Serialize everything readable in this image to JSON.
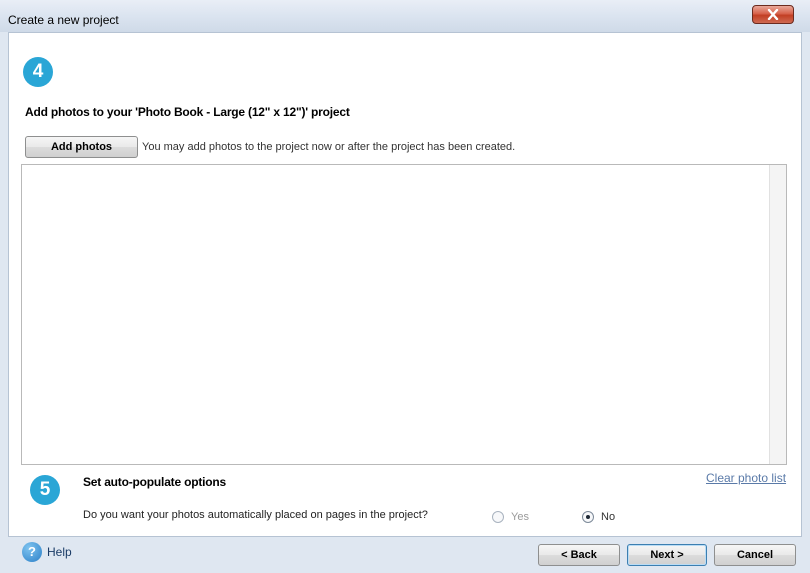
{
  "window": {
    "title": "Create a new project"
  },
  "step4": {
    "number": "4",
    "heading": "Add photos to your 'Photo Book - Large (12\" x 12\")' project",
    "add_photos_label": "Add photos",
    "note": "You may add photos to the project now or after the project has been created."
  },
  "photo_list": {
    "items": []
  },
  "step5": {
    "number": "5",
    "heading": "Set auto-populate options",
    "clear_link": "Clear photo list",
    "question": "Do you want your photos automatically placed on pages in the project?",
    "options": [
      {
        "label": "Yes",
        "selected": false,
        "enabled": false
      },
      {
        "label": "No",
        "selected": true,
        "enabled": true
      }
    ]
  },
  "footer": {
    "help_icon_glyph": "?",
    "help_label": "Help",
    "back_label": "< Back",
    "next_label": "Next >",
    "cancel_label": "Cancel"
  },
  "colors": {
    "accent": "#2aa6d6",
    "link": "#5a7aa8",
    "close": "#c23f24"
  },
  "icons": [
    "close-icon",
    "help-icon"
  ]
}
